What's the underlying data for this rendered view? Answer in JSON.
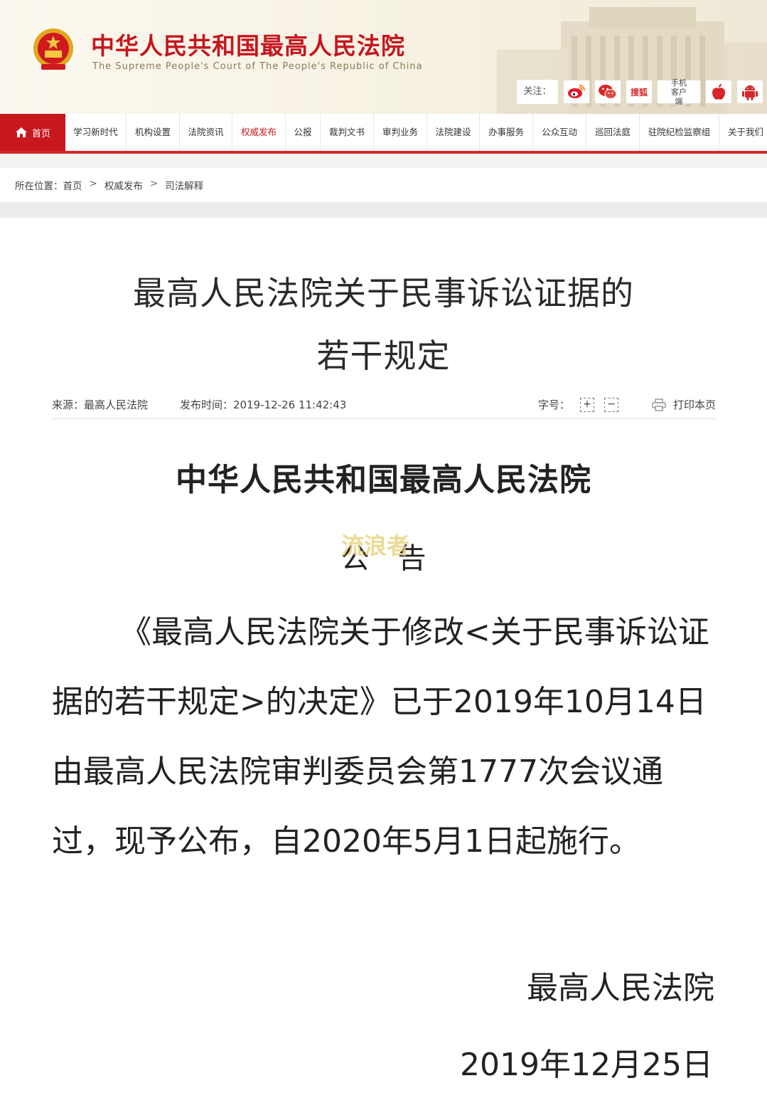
{
  "header": {
    "title": "中华人民共和国最高人民法院",
    "subtitle": "The Supreme People's Court of The People's Republic of China",
    "follow_label": "关注：",
    "sohu_label": "搜狐",
    "mobile_label": "手机客户端",
    "icons": [
      "weibo-icon",
      "wechat-icon",
      "sohu-icon",
      "mobile-client-icon",
      "apple-icon",
      "android-icon"
    ]
  },
  "nav": {
    "home": "首页",
    "items": [
      {
        "label": "学习新时代",
        "active": false
      },
      {
        "label": "机构设置",
        "active": false
      },
      {
        "label": "法院资讯",
        "active": false
      },
      {
        "label": "权威发布",
        "active": true
      },
      {
        "label": "公报",
        "active": false
      },
      {
        "label": "裁判文书",
        "active": false
      },
      {
        "label": "审判业务",
        "active": false
      },
      {
        "label": "法院建设",
        "active": false
      },
      {
        "label": "办事服务",
        "active": false
      },
      {
        "label": "公众互动",
        "active": false
      },
      {
        "label": "巡回法庭",
        "active": false
      },
      {
        "label": "驻院纪检监察组",
        "active": false
      },
      {
        "label": "关于我们",
        "active": false
      }
    ]
  },
  "breadcrumb": {
    "prefix": "所在位置：",
    "items": [
      "首页",
      "权威发布",
      "司法解释"
    ],
    "separator": ">"
  },
  "article": {
    "title_line1": "最高人民法院关于民事诉讼证据的",
    "title_line2": "若干规定",
    "source": "来源：最高人民法院",
    "time": "发布时间：2019-12-26 11:42:43",
    "font_size_label": "字号：",
    "zoom_in": "+",
    "zoom_out": "−",
    "print_label": "打印本页",
    "org": "中华人民共和国最高人民法院",
    "notice": "公告",
    "watermark": "流浪者",
    "body": "《最高人民法院关于修改<关于民事诉讼证据的若干规定>的决定》已于2019年10月14日由最高人民法院审判委员会第1777次会议通过，现予公布，自2020年5月1日起施行。",
    "signature": "最高人民法院",
    "date": "2019年12月25日"
  },
  "colors": {
    "brand_red": "#c9171e",
    "accent_red": "#d7262a",
    "header_bg": "#f6f1e2"
  }
}
